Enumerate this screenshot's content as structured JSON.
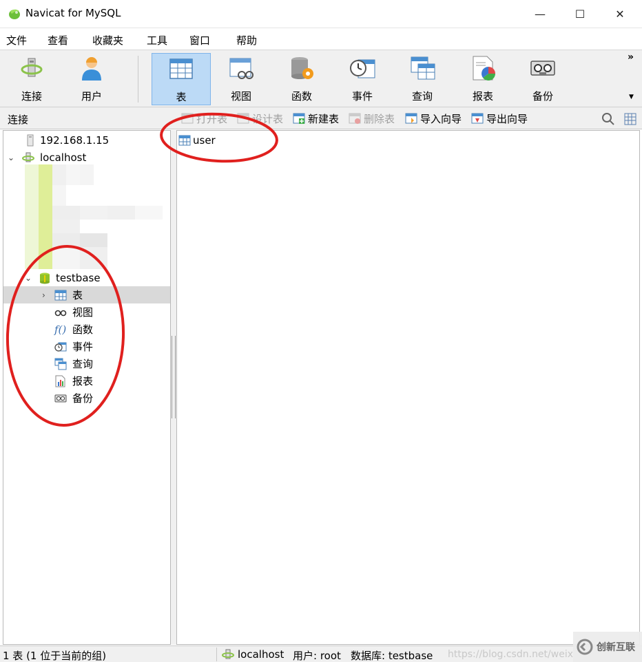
{
  "window": {
    "title": "Navicat for MySQL",
    "minimize": "—",
    "maximize": "☐",
    "close": "✕"
  },
  "menu": [
    "文件",
    "查看",
    "收藏夹",
    "工具",
    "窗口",
    "帮助"
  ],
  "toolbar": {
    "items": [
      {
        "label": "连接",
        "icon": "connection-icon"
      },
      {
        "label": "用户",
        "icon": "user-icon"
      },
      {
        "label": "表",
        "icon": "table-icon",
        "active": true
      },
      {
        "label": "视图",
        "icon": "view-icon"
      },
      {
        "label": "函数",
        "icon": "function-icon"
      },
      {
        "label": "事件",
        "icon": "event-icon"
      },
      {
        "label": "查询",
        "icon": "query-icon"
      },
      {
        "label": "报表",
        "icon": "report-icon"
      },
      {
        "label": "备份",
        "icon": "backup-icon"
      }
    ],
    "more": "»",
    "dropdown": "▼"
  },
  "subbar": {
    "connection_label": "连接",
    "buttons": [
      {
        "label": "打开表",
        "enabled": false
      },
      {
        "label": "设计表",
        "enabled": false
      },
      {
        "label": "新建表",
        "enabled": true
      },
      {
        "label": "删除表",
        "enabled": false
      },
      {
        "label": "导入向导",
        "enabled": true
      },
      {
        "label": "导出向导",
        "enabled": true
      }
    ]
  },
  "tree": {
    "connections": [
      {
        "label": "192.168.1.15"
      },
      {
        "label": "localhost",
        "expanded": true
      }
    ],
    "database": {
      "label": "testbase",
      "expanded": true
    },
    "db_items": [
      {
        "label": "表",
        "selected": true
      },
      {
        "label": "视图"
      },
      {
        "label": "函数"
      },
      {
        "label": "事件"
      },
      {
        "label": "查询"
      },
      {
        "label": "报表"
      },
      {
        "label": "备份"
      }
    ],
    "function_glyph": "f()"
  },
  "objects": [
    {
      "label": "user"
    }
  ],
  "status": {
    "left": "1 表 (1 位于当前的组)",
    "connection": "localhost",
    "user": "用户: root",
    "database": "数据库: testbase",
    "watermark_url": "https://blog.csdn.net/weix",
    "logo_text": "创新互联"
  },
  "colors": {
    "annotation_red": "#e0201e",
    "toolbar_active": "#bcdaf6",
    "selected_row": "#d9d9d9"
  }
}
